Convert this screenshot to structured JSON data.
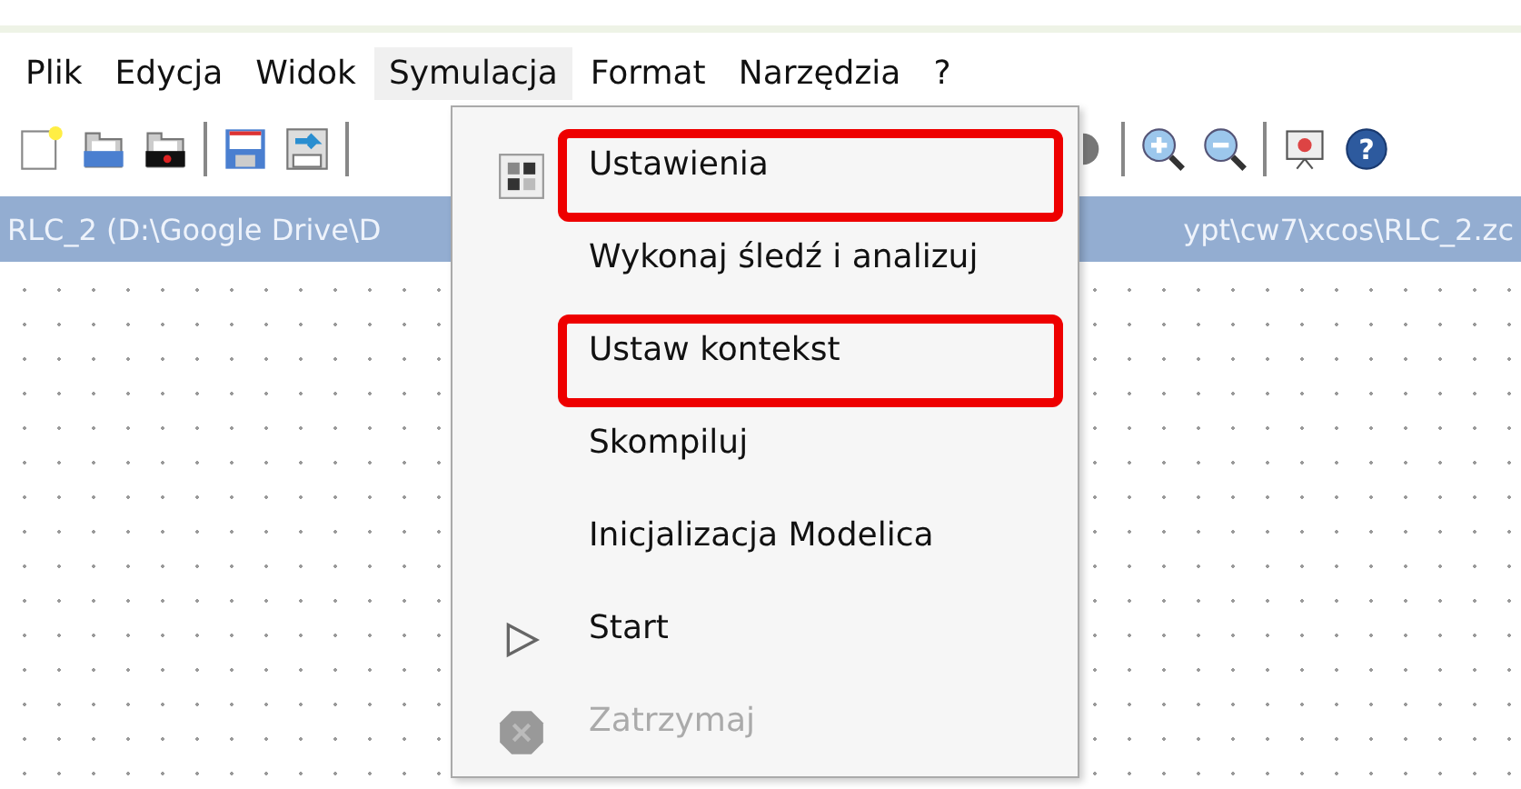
{
  "menubar": [
    {
      "label": "Plik",
      "selected": false
    },
    {
      "label": "Edycja",
      "selected": false
    },
    {
      "label": "Widok",
      "selected": false
    },
    {
      "label": "Symulacja",
      "selected": true
    },
    {
      "label": "Format",
      "selected": false
    },
    {
      "label": "Narzędzia",
      "selected": false
    },
    {
      "label": "?",
      "selected": false
    }
  ],
  "toolbar": {
    "help_glyph": "?"
  },
  "title_bar": {
    "left": "RLC_2 (D:\\Google Drive\\D",
    "right": "ypt\\cw7\\xcos\\RLC_2.zc"
  },
  "menu": [
    {
      "label": "Ustawienia",
      "kind": "settings",
      "disabled": false,
      "annotated": true
    },
    {
      "label": "Wykonaj śledź i analizuj",
      "kind": "plain",
      "disabled": false,
      "annotated": false
    },
    {
      "label": "Ustaw kontekst",
      "kind": "plain",
      "disabled": false,
      "annotated": true
    },
    {
      "label": "Skompiluj",
      "kind": "plain",
      "disabled": false,
      "annotated": false
    },
    {
      "label": "Inicjalizacja Modelica",
      "kind": "plain",
      "disabled": false,
      "annotated": false
    },
    {
      "label": "Start",
      "kind": "play",
      "disabled": false,
      "annotated": false
    },
    {
      "label": "Zatrzymaj",
      "kind": "stop",
      "disabled": true,
      "annotated": false
    }
  ]
}
